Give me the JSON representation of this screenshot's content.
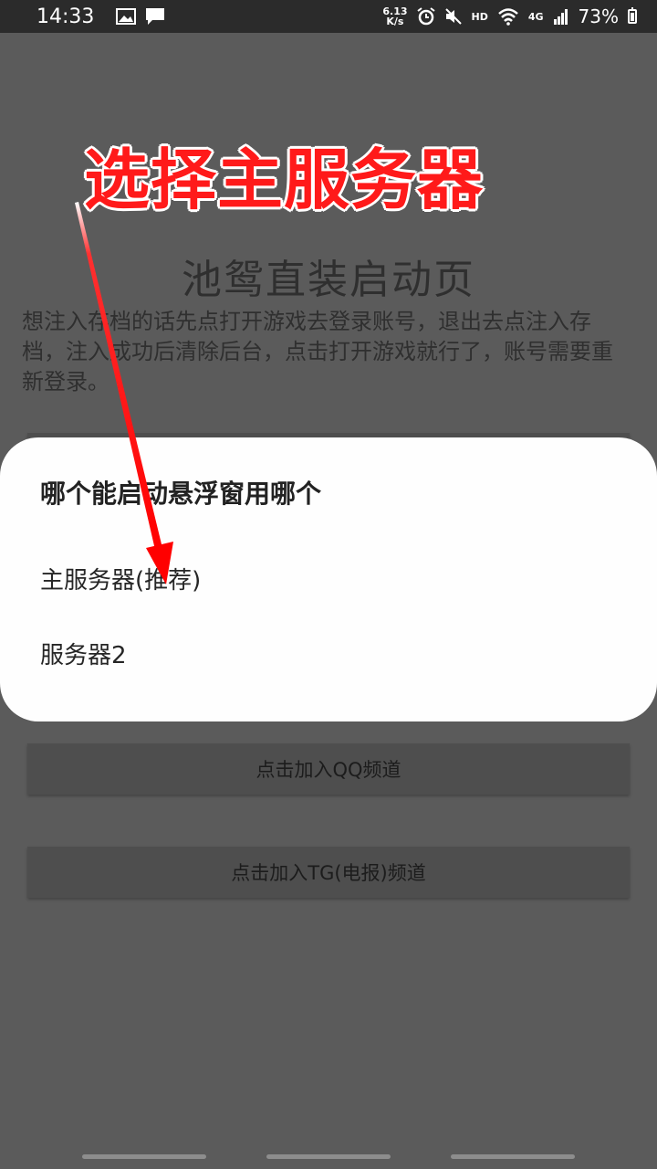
{
  "status_bar": {
    "time": "14:33",
    "net_speed_value": "6.13",
    "net_speed_unit": "K/s",
    "hd_label": "HD",
    "network_label": "4G",
    "battery": "73%",
    "icons": [
      "image-icon",
      "message-icon",
      "alarm-icon",
      "mute-icon",
      "wifi-icon",
      "signal-icon",
      "battery-icon"
    ]
  },
  "page": {
    "title": "池鸳直装启动页",
    "description": "想注入存档的话先点打开游戏去登录账号，退出去点注入存档，注入成功后清除后台，点击打开游戏就行了，账号需要重新登录。",
    "buttons": {
      "qq": "点击加入QQ频道",
      "tg": "点击加入TG(电报)频道"
    }
  },
  "dialog": {
    "title": "哪个能启动悬浮窗用哪个",
    "options": [
      "主服务器(推荐)",
      "服务器2"
    ]
  },
  "annotation": {
    "text": "选择主服务器",
    "color": "#ff1a1a"
  }
}
